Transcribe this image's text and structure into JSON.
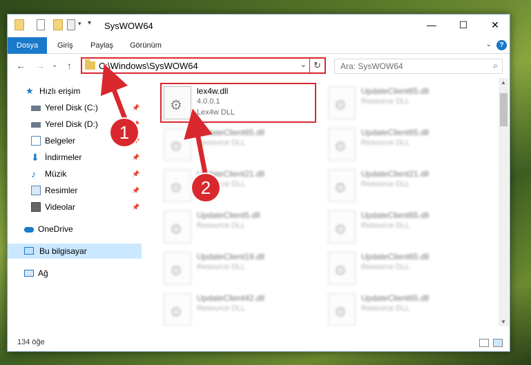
{
  "window": {
    "title": "SysWOW64"
  },
  "ribbon": {
    "file_tab": "Dosya",
    "tabs": [
      "Giriş",
      "Paylaş",
      "Görünüm"
    ]
  },
  "address": {
    "path": "C:\\Windows\\SysWOW64",
    "search_placeholder": "Ara: SysWOW64"
  },
  "sidebar": {
    "quick_access": "Hızlı erişim",
    "items": [
      {
        "label": "Yerel Disk (C:)",
        "icon": "drive-icon",
        "pinned": true
      },
      {
        "label": "Yerel Disk (D:)",
        "icon": "drive-icon",
        "pinned": true
      },
      {
        "label": "Belgeler",
        "icon": "documents-icon",
        "pinned": true
      },
      {
        "label": "İndirmeler",
        "icon": "download-icon",
        "pinned": true
      },
      {
        "label": "Müzik",
        "icon": "music-icon",
        "pinned": true
      },
      {
        "label": "Resimler",
        "icon": "pictures-icon",
        "pinned": true
      },
      {
        "label": "Videolar",
        "icon": "videos-icon",
        "pinned": true
      }
    ],
    "onedrive": "OneDrive",
    "this_pc": "Bu bilgisayar",
    "network": "Ağ"
  },
  "files": {
    "highlighted": {
      "name": "lex4w.dll",
      "version": "4.0.0.1",
      "description": "Lex4w DLL"
    },
    "left_column": [
      {
        "name": "UpdateClient65.dll",
        "description": "Resource DLL"
      },
      {
        "name": "UpdateClient21.dll",
        "description": "Resource DLL"
      },
      {
        "name": "UpdateClient5.dll",
        "description": "Resource DLL"
      },
      {
        "name": "UpdateClient19.dll",
        "description": "Resource DLL"
      },
      {
        "name": "UpdateClient42.dll",
        "description": "Resource DLL"
      }
    ],
    "right_column": [
      {
        "name": "UpdateClient65.dll",
        "description": "Resource DLL"
      },
      {
        "name": "UpdateClient65.dll",
        "description": "Resource DLL"
      },
      {
        "name": "UpdateClient21.dll",
        "description": "Resource DLL"
      },
      {
        "name": "UpdateClient65.dll",
        "description": "Resource DLL"
      },
      {
        "name": "UpdateClient65.dll",
        "description": "Resource DLL"
      },
      {
        "name": "UpdateClient65.dll",
        "description": "Resource DLL"
      }
    ]
  },
  "status": {
    "count": "134 öğe"
  },
  "annotations": {
    "step1": "1",
    "step2": "2",
    "color": "#d9272e"
  }
}
